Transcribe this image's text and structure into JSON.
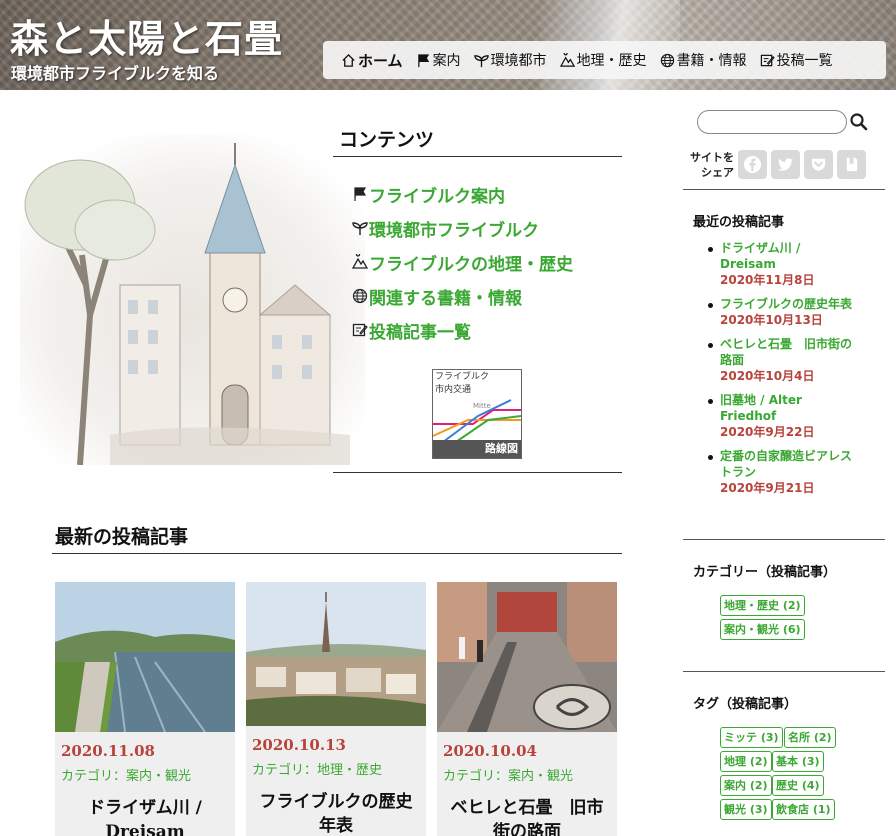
{
  "site": {
    "title": "森と太陽と石畳",
    "subtitle": "環境都市フライブルクを知る"
  },
  "nav": [
    {
      "label": "ホーム",
      "icon": "home-icon"
    },
    {
      "label": "案内",
      "icon": "flag-icon"
    },
    {
      "label": "環境都市",
      "icon": "sprout-icon"
    },
    {
      "label": "地理・歴史",
      "icon": "mountain-icon"
    },
    {
      "label": "書籍・情報",
      "icon": "globe-icon"
    },
    {
      "label": "投稿一覧",
      "icon": "edit-icon"
    }
  ],
  "contents": {
    "title": "コンテンツ",
    "links": [
      {
        "label": "フライブルク案内",
        "icon": "flag-icon"
      },
      {
        "label": "環境都市フライブルク",
        "icon": "sprout-icon"
      },
      {
        "label": "フライブルクの地理・歴史",
        "icon": "mountain-icon"
      },
      {
        "label": "関連する書籍・情報",
        "icon": "globe-icon"
      },
      {
        "label": "投稿記事一覧",
        "icon": "edit-icon"
      }
    ],
    "route_map": {
      "line1": "フライブルク",
      "line2": "市内交通",
      "station": "Mitte",
      "footer": "路線図"
    }
  },
  "latest": {
    "title": "最新の投稿記事",
    "posts": [
      {
        "date": "2020.11.08",
        "category": "カテゴリ：案内・観光",
        "title": "ドライザム川 / Dreisam"
      },
      {
        "date": "2020.10.13",
        "category": "カテゴリ：地理・歴史",
        "title": "フライブルクの歴史年表"
      },
      {
        "date": "2020.10.04",
        "category": "カテゴリ：案内・観光",
        "title": "ベヒレと石畳　旧市街の路面"
      }
    ]
  },
  "sidebar": {
    "search_placeholder": "",
    "share_label_1": "サイトを",
    "share_label_2": "シェア",
    "share_buttons": [
      "facebook-icon",
      "twitter-icon",
      "pocket-icon",
      "bookmark-icon"
    ],
    "recent_heading": "最近の投稿記事",
    "recent": [
      {
        "title": "ドライザム川 / Dreisam",
        "date": "2020年11月8日"
      },
      {
        "title": "フライブルクの歴史年表",
        "date": "2020年10月13日"
      },
      {
        "title": "ベヒレと石畳　旧市街の路面",
        "date": "2020年10月4日"
      },
      {
        "title": "旧墓地 / Alter Friedhof",
        "date": "2020年9月22日"
      },
      {
        "title": "定番の自家醸造ビアレストラン",
        "date": "2020年9月21日"
      }
    ],
    "category_heading": "カテゴリー（投稿記事）",
    "categories": [
      "地理・歴史 (2)",
      "案内・観光 (6)"
    ],
    "tag_heading": "タグ（投稿記事）",
    "tags": [
      "ミッテ (3)",
      "名所 (2)",
      "地理 (2)",
      "基本 (3)",
      "案内 (2)",
      "歴史 (4)",
      "観光 (3)",
      "飲食店 (1)"
    ]
  },
  "colors": {
    "link_green": "#3aa832",
    "date_red": "#b8433a"
  }
}
